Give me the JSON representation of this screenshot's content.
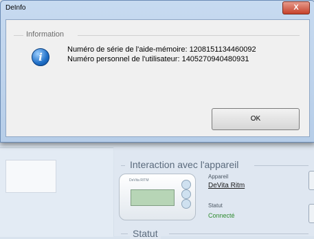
{
  "dialog": {
    "title": "DeInfo",
    "close_label": "X",
    "group_label": "Information",
    "icon": "info-icon",
    "message_line1": "Numéro de série de l'aide-mémoire: 1208151134460092",
    "message_line2": "Numéro personnel de l'utilisateur: 1405270940480931",
    "ok_label": "OK"
  },
  "background": {
    "device_group_title": "Interaction avec l'appareil",
    "device_label": "Appareil",
    "device_name": "DeVita Ritm",
    "status_label": "Statut",
    "status_value": "Connecté",
    "status_group_title": "Statut",
    "device_image_text": "DeVita RITM"
  },
  "colors": {
    "status_connected": "#2e8b2e",
    "close_button": "#c6412b",
    "dialog_frame": "#b6cde8"
  }
}
